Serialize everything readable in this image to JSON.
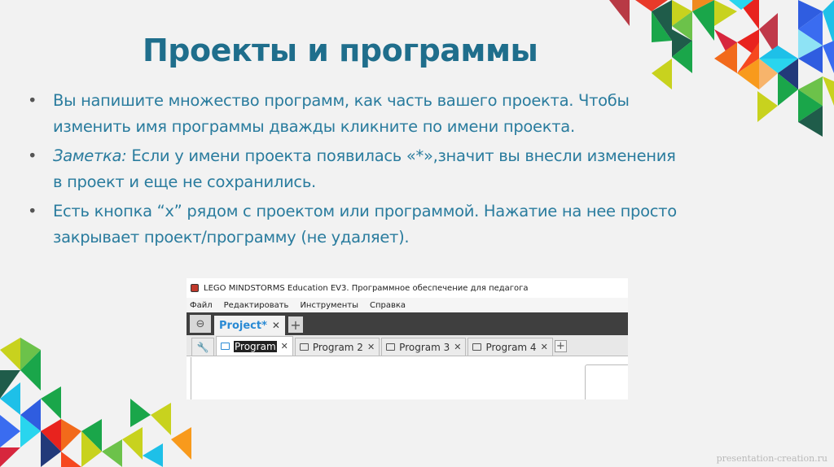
{
  "slide": {
    "title": "Проекты и программы",
    "bullets": [
      {
        "text": "Вы напишите множество программ, как часть вашего проекта. Чтобы изменить имя программы дважды кликните по имени проекта."
      },
      {
        "label": "Заметка:",
        "text": " Если у имени проекта появилась «*»,значит вы внесли изменения в проект и еще не сохранились."
      },
      {
        "text": "Есть кнопка “x” рядом с проектом или программой. Нажатие на нее просто закрывает проект/программу (не удаляет)."
      }
    ],
    "watermark": "presentation-creation.ru"
  },
  "screenshot": {
    "window_title": "LEGO MINDSTORMS Education EV3. Программное обеспечение для педагога",
    "menu": [
      "Файл",
      "Редактировать",
      "Инструменты",
      "Справка"
    ],
    "project_tab": "Project*",
    "close_glyph": "✕",
    "add_glyph": "+",
    "program_tabs": [
      "Program",
      "Program 2",
      "Program 3",
      "Program 4"
    ]
  },
  "colors": {
    "title": "#1f6e8c",
    "body": "#2a7c9e",
    "accent": "#2a8ad4"
  }
}
